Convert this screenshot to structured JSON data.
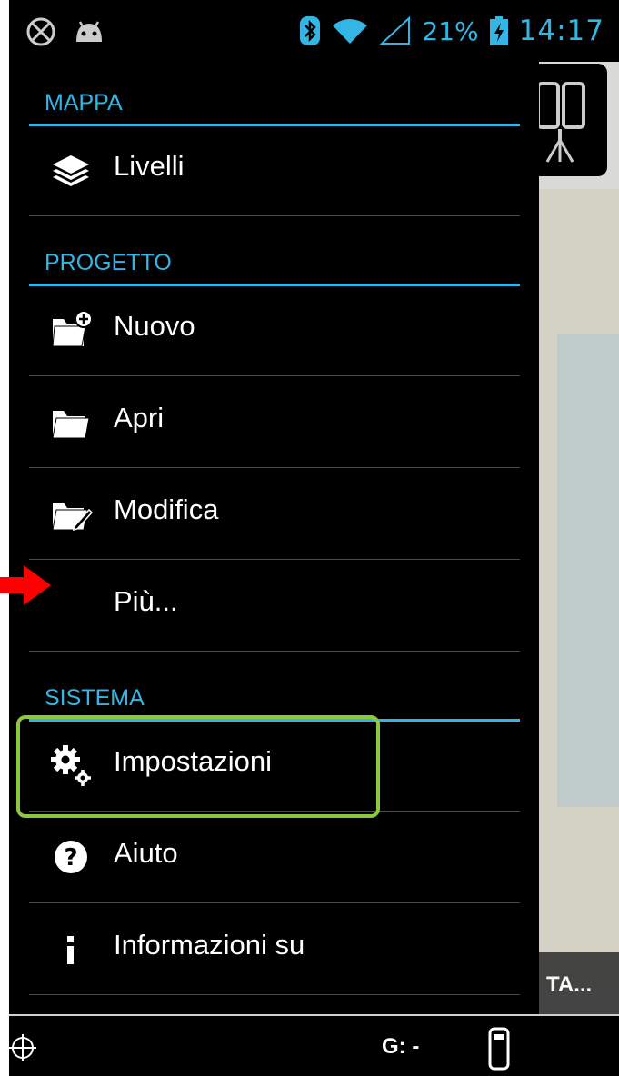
{
  "status_bar": {
    "battery": "21%",
    "time": "14:17",
    "icons": [
      "no-gps-icon",
      "android-icon",
      "bluetooth-icon",
      "wifi-icon",
      "signal-icon",
      "battery-charging-icon"
    ]
  },
  "drawer": {
    "sections": {
      "mappa": "MAPPA",
      "progetto": "PROGETTO",
      "sistema": "SISTEMA"
    },
    "items": {
      "livelli": "Livelli",
      "nuovo": "Nuovo",
      "apri": "Apri",
      "modifica": "Modifica",
      "piu": "Più...",
      "impostazioni": "Impostazioni",
      "aiuto": "Aiuto",
      "informazioni": "Informazioni su"
    }
  },
  "map": {
    "bottom_label": "TA..."
  },
  "bottom_bar": {
    "gnss_label": "G: -"
  },
  "colors": {
    "accent": "#33b5e5",
    "highlight": "#8dc63f",
    "arrow": "#ff0000",
    "background": "#000000"
  }
}
